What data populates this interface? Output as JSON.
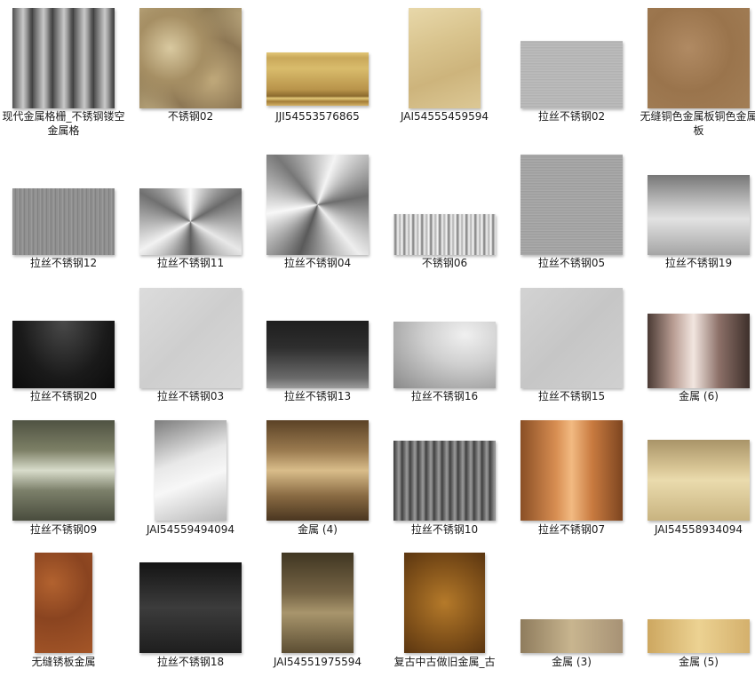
{
  "files": [
    {
      "label": "现代金属格栅_不锈钢镂空金属格",
      "texture": "vertical-grille"
    },
    {
      "label": "不锈钢02",
      "texture": "gold-marble"
    },
    {
      "label": "JJI54553576865",
      "texture": "gold-drum"
    },
    {
      "label": "JAI54555459594",
      "texture": "champagne-gold"
    },
    {
      "label": "拉丝不锈钢02",
      "texture": "brushed-silver"
    },
    {
      "label": "无缝铜色金属板铜色金属板",
      "texture": "copper-plate"
    },
    {
      "label": "拉丝不锈钢12",
      "texture": "brushed-grey"
    },
    {
      "label": "拉丝不锈钢11",
      "texture": "radial-silver"
    },
    {
      "label": "拉丝不锈钢04",
      "texture": "radial-silver-large"
    },
    {
      "label": "不锈钢06",
      "texture": "white-grunge"
    },
    {
      "label": "拉丝不锈钢05",
      "texture": "brushed-fine"
    },
    {
      "label": "拉丝不锈钢19",
      "texture": "brushed-light"
    },
    {
      "label": "拉丝不锈钢20",
      "texture": "brushed-black"
    },
    {
      "label": "拉丝不锈钢03",
      "texture": "matte-light"
    },
    {
      "label": "拉丝不锈钢13",
      "texture": "brushed-dark"
    },
    {
      "label": "拉丝不锈钢16",
      "texture": "satin-grey"
    },
    {
      "label": "拉丝不锈钢15",
      "texture": "matte-silver"
    },
    {
      "label": "金属 (6)",
      "texture": "rose-chrome"
    },
    {
      "label": "拉丝不锈钢09",
      "texture": "olive-chrome"
    },
    {
      "label": "JAI54559494094",
      "texture": "silver-gradient"
    },
    {
      "label": "金属 (4)",
      "texture": "bronze-brushed"
    },
    {
      "label": "拉丝不锈钢10",
      "texture": "gunmetal"
    },
    {
      "label": "拉丝不锈钢07",
      "texture": "copper-brushed"
    },
    {
      "label": "JAI54558934094",
      "texture": "light-gold"
    },
    {
      "label": "无缝锈板金属",
      "texture": "rust"
    },
    {
      "label": "拉丝不锈钢18",
      "texture": "black-brushed"
    },
    {
      "label": "JAI54551975594",
      "texture": "bronze-dark"
    },
    {
      "label": "复古中古做旧金属_古",
      "texture": "antique-gold"
    },
    {
      "label": "金属 (3)",
      "texture": "champagne-strip"
    },
    {
      "label": "金属 (5)",
      "texture": "gold-strip"
    }
  ]
}
